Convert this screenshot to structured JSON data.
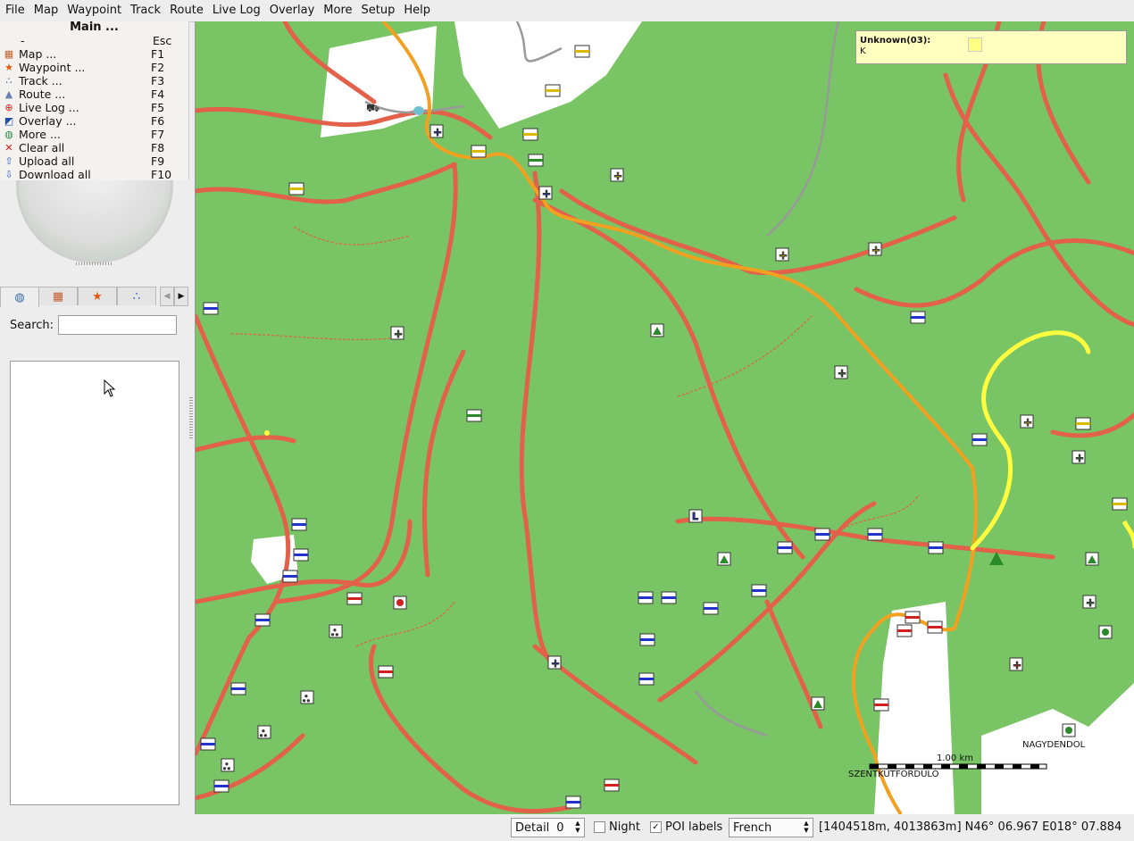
{
  "menubar": {
    "items": [
      "File",
      "Map",
      "Waypoint",
      "Track",
      "Route",
      "Live Log",
      "Overlay",
      "More",
      "Setup",
      "Help"
    ]
  },
  "dropdown": {
    "title": "Main ...",
    "items": [
      {
        "label": "-",
        "key": "Esc",
        "icon": "none"
      },
      {
        "label": "Map ...",
        "key": "F1",
        "icon": "map-icon"
      },
      {
        "label": "Waypoint ...",
        "key": "F2",
        "icon": "star-icon"
      },
      {
        "label": "Track ...",
        "key": "F3",
        "icon": "track-icon"
      },
      {
        "label": "Route ...",
        "key": "F4",
        "icon": "route-icon"
      },
      {
        "label": "Live Log ...",
        "key": "F5",
        "icon": "livelog-icon"
      },
      {
        "label": "Overlay ...",
        "key": "F6",
        "icon": "overlay-icon"
      },
      {
        "label": "More ...",
        "key": "F7",
        "icon": "globe-icon"
      },
      {
        "label": "Clear all",
        "key": "F8",
        "icon": "clear-icon"
      },
      {
        "label": "Upload all",
        "key": "F9",
        "icon": "upload-icon"
      },
      {
        "label": "Download all",
        "key": "F10",
        "icon": "download-icon"
      }
    ]
  },
  "sidebar": {
    "tabs": [
      "globe-icon",
      "map-icon",
      "star-icon",
      "track-icon"
    ],
    "search_label": "Search:",
    "search_value": ""
  },
  "infobox": {
    "title": "Unknown(03):",
    "subtitle": "K"
  },
  "map_labels": {
    "scale": "1.00 km",
    "place1": "NAGYDENDOL",
    "place2": "SZENTKÚTFORDULÓ"
  },
  "statusbar": {
    "detail_label": "Detail",
    "detail_value": "0",
    "night_label": "Night",
    "night_checked": false,
    "poi_label": "POI labels",
    "poi_checked": true,
    "language": "French",
    "coords": "[1404518m, 4013863m] N46° 06.967 E018° 07.884"
  },
  "colors": {
    "map_bg": "#79c464",
    "path": "#e3604a",
    "road_orange": "#f2a020",
    "road_yellow": "#ffff40",
    "info_bg": "#ffffc0"
  }
}
